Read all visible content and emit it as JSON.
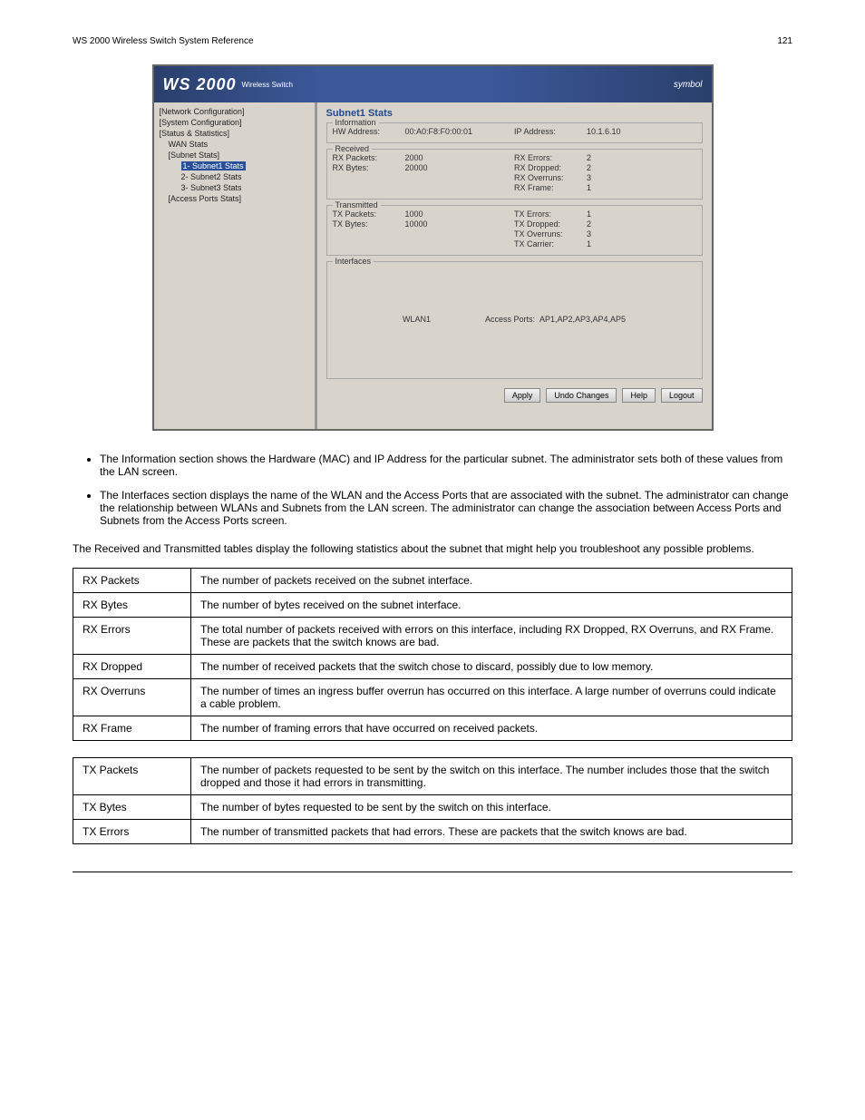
{
  "header": {
    "left": "WS 2000 Wireless Switch System Reference",
    "right": "121"
  },
  "screenshot": {
    "banner": {
      "title": "WS 2000",
      "subtitle": "Wireless Switch",
      "brand": "symbol"
    },
    "tree": {
      "n0": "[Network Configuration]",
      "n1": "[System Configuration]",
      "n2": "[Status & Statistics]",
      "n3": "WAN Stats",
      "n4": "[Subnet Stats]",
      "n5": "1- Subnet1 Stats",
      "n6": "2- Subnet2 Stats",
      "n7": "3- Subnet3 Stats",
      "n8": "[Access Ports Stats]"
    },
    "content": {
      "title": "Subnet1 Stats",
      "info_legend": "Information",
      "hw_label": "HW Address:",
      "hw_value": "00:A0:F8:F0:00:01",
      "ip_label": "IP Address:",
      "ip_value": "10.1.6.10",
      "recv_legend": "Received",
      "rx_packets_l": "RX Packets:",
      "rx_packets_v": "2000",
      "rx_bytes_l": "RX Bytes:",
      "rx_bytes_v": "20000",
      "rx_errors_l": "RX Errors:",
      "rx_errors_v": "2",
      "rx_dropped_l": "RX Dropped:",
      "rx_dropped_v": "2",
      "rx_overruns_l": "RX Overruns:",
      "rx_overruns_v": "3",
      "rx_frame_l": "RX Frame:",
      "rx_frame_v": "1",
      "trans_legend": "Transmitted",
      "tx_packets_l": "TX Packets:",
      "tx_packets_v": "1000",
      "tx_bytes_l": "TX Bytes:",
      "tx_bytes_v": "10000",
      "tx_errors_l": "TX Errors:",
      "tx_errors_v": "1",
      "tx_dropped_l": "TX Dropped:",
      "tx_dropped_v": "2",
      "tx_overruns_l": "TX Overruns:",
      "tx_overruns_v": "3",
      "tx_carrier_l": "TX Carrier:",
      "tx_carrier_v": "1",
      "ifaces_legend": "Interfaces",
      "wlan_label": "WLAN1",
      "ap_label": "Access Ports:",
      "ap_value": "AP1,AP2,AP3,AP4,AP5",
      "buttons": {
        "apply": "Apply",
        "undo": "Undo Changes",
        "help": "Help",
        "logout": "Logout"
      }
    }
  },
  "bullets": {
    "b1": "The Information section shows the Hardware (MAC) and IP Address for the particular subnet. The administrator sets both of these values from the LAN screen.",
    "b2": "The Interfaces section displays the name of the WLAN and the Access Ports that are associated with the subnet. The administrator can change the relationship between WLANs and Subnets from the LAN screen. The administrator can change the association between Access Ports and Subnets from the Access Ports screen."
  },
  "intro": "The Received and Transmitted tables display the following statistics about the subnet that might help you troubleshoot any possible problems.",
  "rxtable": {
    "r1k": "RX Packets",
    "r1v": "The number of packets received on the subnet interface.",
    "r2k": "RX Bytes",
    "r2v": "The number of bytes received on the subnet interface.",
    "r3k": "RX Errors",
    "r3v": "The total number of packets received with errors on this interface, including RX Dropped, RX Overruns, and RX Frame. These are packets that the switch knows are bad.",
    "r4k": "RX Dropped",
    "r4v": "The number of received packets that the switch chose to discard, possibly due to low memory.",
    "r5k": "RX Overruns",
    "r5v": "The number of times an ingress buffer overrun has occurred on this interface. A large number of overruns could indicate a cable problem.",
    "r6k": "RX Frame",
    "r6v": "The number of framing errors that have occurred on received packets."
  },
  "txtable": {
    "t1k": "TX Packets",
    "t1v": "The number of packets requested to be sent by the switch on this interface. The number includes those that the switch dropped and those it had errors in transmitting.",
    "t2k": "TX Bytes",
    "t2v": "The number of bytes requested to be sent by the switch on this interface.",
    "t3k": "TX Errors",
    "t3v": "The number of transmitted packets that had errors. These are packets that the switch knows are bad."
  },
  "footer": {
    "left": "",
    "right": ""
  }
}
